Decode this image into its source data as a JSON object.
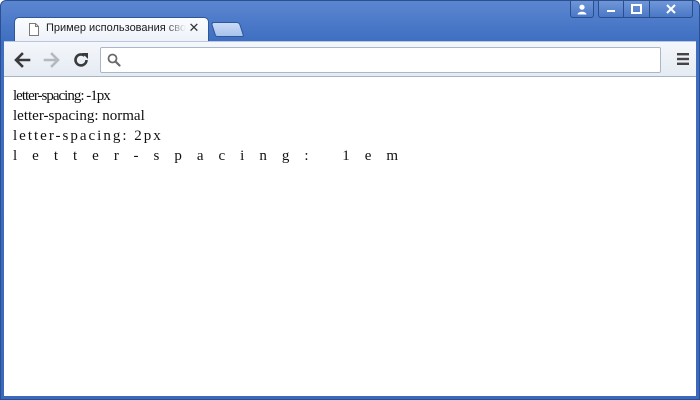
{
  "window": {
    "tab_title": "Пример использования свойства letter-spacing",
    "controls": {
      "profile_icon": "person-icon",
      "minimize_icon": "minimize-icon",
      "maximize_icon": "maximize-icon",
      "close_icon": "close-icon"
    }
  },
  "toolbar": {
    "back_icon": "arrow-left-icon",
    "forward_icon": "arrow-right-icon",
    "reload_icon": "reload-icon",
    "search_icon": "search-icon",
    "menu_icon": "hamburger-menu-icon",
    "address_value": ""
  },
  "page": {
    "lines": [
      "letter-spacing: -1px",
      "letter-spacing: normal",
      "letter-spacing: 2px",
      "letter-spacing: 1em"
    ]
  },
  "colors": {
    "frame": "#3f6fc2",
    "toolbar": "#eef2f8",
    "content_bg": "#ffffff"
  }
}
